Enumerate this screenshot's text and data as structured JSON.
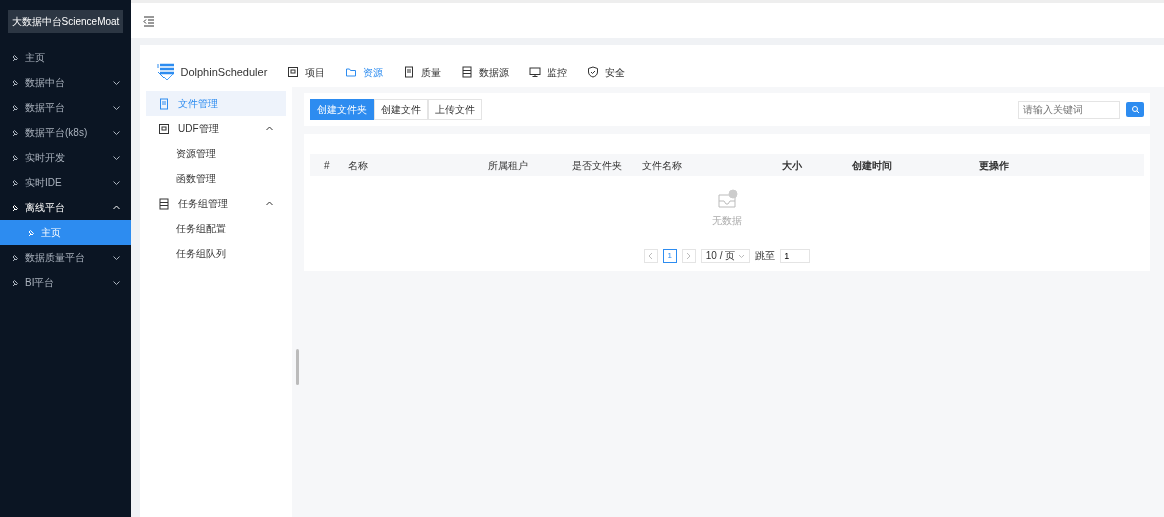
{
  "sidebar": {
    "title": "大数据中台ScienceMoat",
    "items": [
      {
        "label": "主页",
        "selected": false
      },
      {
        "label": "数据中台",
        "expanded": false,
        "selected": false
      },
      {
        "label": "数据平台",
        "expanded": false,
        "selected": false
      },
      {
        "label": "数据平台(k8s)",
        "expanded": false,
        "selected": false
      },
      {
        "label": "实时开发",
        "expanded": false,
        "selected": false
      },
      {
        "label": "实时IDE",
        "expanded": false,
        "selected": false
      },
      {
        "label": "离线平台",
        "expanded": true,
        "selected": false,
        "children": [
          {
            "label": "主页",
            "selected": true
          }
        ]
      },
      {
        "label": "数据质量平台",
        "expanded": false,
        "selected": false
      },
      {
        "label": "BI平台",
        "expanded": false,
        "selected": false
      }
    ]
  },
  "app": {
    "logo": "DolphinScheduler",
    "tabs": [
      {
        "label": "项目",
        "kind": "grid",
        "selected": false
      },
      {
        "label": "资源",
        "kind": "folder",
        "selected": true
      },
      {
        "label": "质量",
        "kind": "doc",
        "selected": false
      },
      {
        "label": "数据源",
        "kind": "db",
        "selected": false
      },
      {
        "label": "监控",
        "kind": "monitor",
        "selected": false
      },
      {
        "label": "安全",
        "kind": "shield",
        "selected": false
      }
    ],
    "menu": [
      {
        "label": "文件管理",
        "kind": "doc",
        "selected": true
      },
      {
        "label": "UDF管理",
        "kind": "grid",
        "selected": false,
        "expanded": true,
        "children": [
          {
            "label": "资源管理",
            "selected": false
          },
          {
            "label": "函数管理",
            "selected": false
          }
        ]
      },
      {
        "label": "任务组管理",
        "kind": "db",
        "selected": false,
        "expanded": true,
        "children": [
          {
            "label": "任务组配置",
            "selected": false
          },
          {
            "label": "任务组队列",
            "selected": false
          }
        ]
      }
    ],
    "buttons": [
      {
        "label": "创建文件夹",
        "primary": true
      },
      {
        "label": "创建文件",
        "primary": false
      },
      {
        "label": "上传文件",
        "primary": false
      }
    ],
    "search": {
      "placeholder": "请输入关键词"
    },
    "table": {
      "columns": [
        "#",
        "名称",
        "所属租户",
        "是否文件夹",
        "文件名称",
        "大小",
        "创建时间",
        "更",
        "操作"
      ],
      "empty_text": "无数据"
    },
    "pagination": {
      "current": "1",
      "page_size": "10 / 页",
      "jump_label": "跳至",
      "jump_value": "1"
    }
  }
}
